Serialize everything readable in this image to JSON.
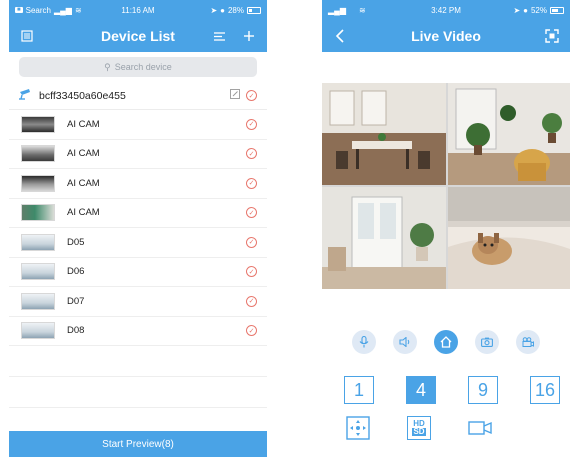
{
  "left_screen": {
    "status": {
      "carrier": "Search",
      "time": "11:16 AM",
      "battery": "28%"
    },
    "nav": {
      "title": "Device List"
    },
    "search": {
      "placeholder": "Search device"
    },
    "group": {
      "name": "bcff33450a60e455"
    },
    "devices": [
      {
        "name": "AI CAM"
      },
      {
        "name": "AI CAM"
      },
      {
        "name": "AI CAM"
      },
      {
        "name": "AI CAM"
      },
      {
        "name": "D05"
      },
      {
        "name": "D06"
      },
      {
        "name": "D07"
      },
      {
        "name": "D08"
      }
    ],
    "start_button": "Start Preview(8)"
  },
  "right_screen": {
    "status": {
      "time": "3:42 PM",
      "battery": "52%"
    },
    "nav": {
      "title": "Live Video"
    },
    "split_options": [
      "1",
      "4",
      "9",
      "16"
    ],
    "selected_split": "4",
    "hd_badge": {
      "top": "HD",
      "bottom": "SD"
    }
  },
  "colors": {
    "accent": "#4aa3e6",
    "check": "#e8776d"
  }
}
